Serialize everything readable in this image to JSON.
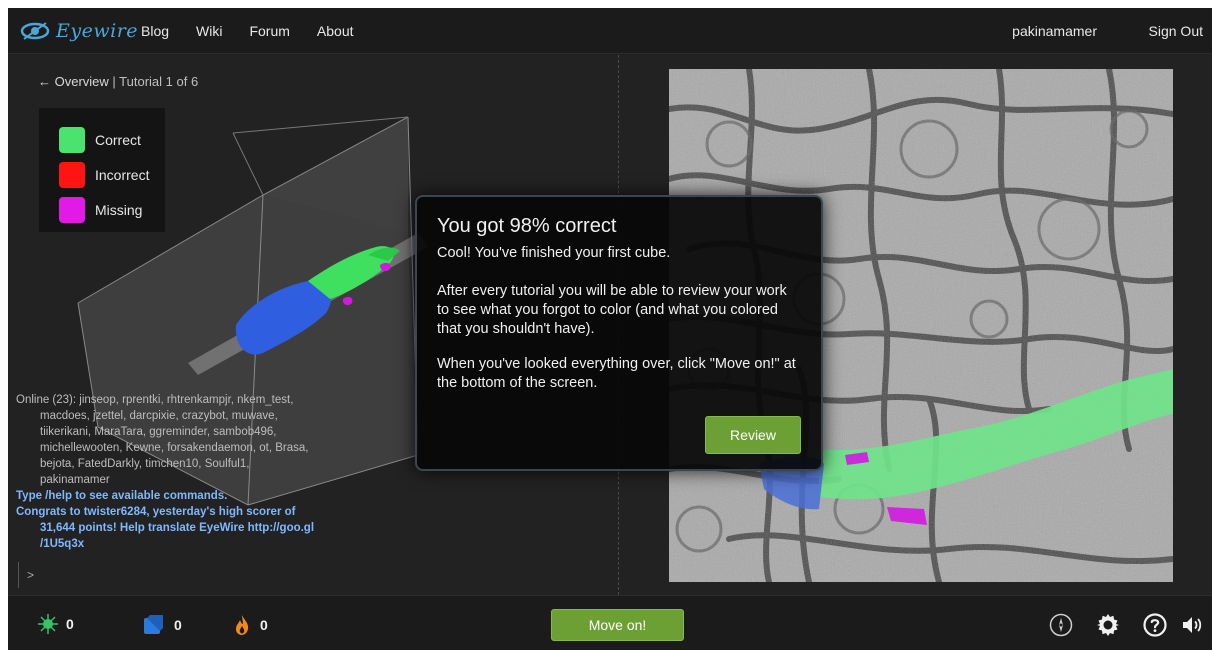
{
  "header": {
    "logo_text": "Eyewire",
    "nav": [
      "Blog",
      "Wiki",
      "Forum",
      "About"
    ],
    "username": "pakinamamer",
    "signout_label": "Sign Out"
  },
  "breadcrumb": {
    "back_label": "← Overview",
    "separator": " | ",
    "current": "Tutorial 1 of 6"
  },
  "legend": [
    {
      "label": "Correct",
      "color": "#4be36f"
    },
    {
      "label": "Incorrect",
      "color": "#ff1414"
    },
    {
      "label": "Missing",
      "color": "#e11ae8"
    }
  ],
  "chat": {
    "online_text": "Online (23): jinseop, rprentki, rhtrenkampjr, nkem_test,",
    "online_lines": [
      "macdoes, jzettel, darcpixie, crazybot, muwave,",
      "tiikerikani, MaraTara, ggreminder, sambob496,",
      "michellewooten, Kewne, forsakendaemon, ot, Brasa,",
      "bejota, FatedDarkly, timchen10, Soulful1,",
      "pakinamamer"
    ],
    "help_text": "Type /help to see available commands.",
    "congrats_first": "Congrats to twister6284, yesterday's high scorer of",
    "congrats_lines": [
      "31,644 points! Help translate EyeWire http://goo.gl",
      "/1U5q3x"
    ],
    "prompt": ">"
  },
  "modal": {
    "title": "You got 98% correct",
    "lines": [
      "Cool! You've finished your first cube.",
      "After every tutorial you will be able to review your work to see what you forgot to color (and what you colored that you shouldn't have).",
      "When you've looked everything over, click \"Move on!\" at the bottom of the screen."
    ],
    "review_label": "Review"
  },
  "footer": {
    "stats": [
      {
        "icon": "neuron-icon",
        "value": "0"
      },
      {
        "icon": "cube-icon",
        "value": "0"
      },
      {
        "icon": "flame-icon",
        "value": "0"
      }
    ],
    "move_on_label": "Move on!"
  },
  "colors": {
    "accent": "#4aa8d8",
    "button_green": "#6da034",
    "segment_green": "#6fe38a",
    "segment_blue": "#2f5fe0"
  }
}
